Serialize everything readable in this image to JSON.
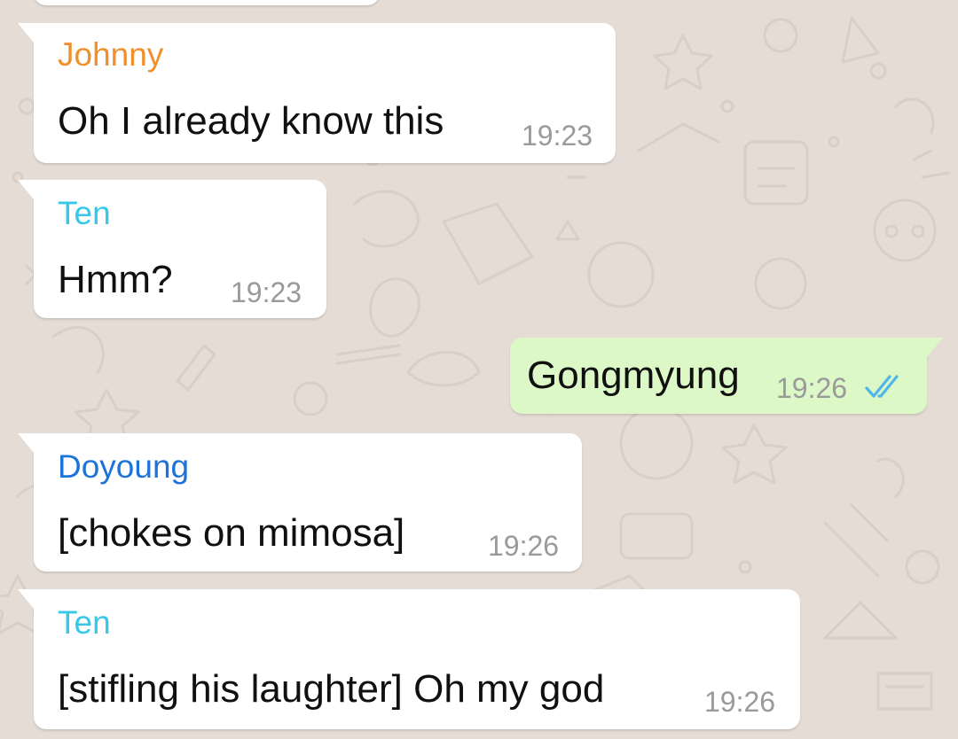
{
  "chat": {
    "messages": [
      {
        "direction": "incoming",
        "sender": "Johnny",
        "sender_color": "#f0902c",
        "text": "Oh I already know this",
        "time": "19:23"
      },
      {
        "direction": "incoming",
        "sender": "Ten",
        "sender_color": "#35c8e8",
        "text": "Hmm?",
        "time": "19:23"
      },
      {
        "direction": "outgoing",
        "text": "Gongmyung",
        "time": "19:26",
        "status_icon": "double-check-read-icon"
      },
      {
        "direction": "incoming",
        "sender": "Doyoung",
        "sender_color": "#1e73d8",
        "text": "[chokes on mimosa]",
        "time": "19:26"
      },
      {
        "direction": "incoming",
        "sender": "Ten",
        "sender_color": "#35c8e8",
        "text": "[stifling his laughter] Oh my god",
        "time": "19:26"
      }
    ]
  },
  "colors": {
    "wallpaper": "#e5ddd5",
    "incoming_bubble": "#ffffff",
    "outgoing_bubble": "#dcf8c6",
    "read_ticks": "#4fb6ec",
    "timestamp": "#9a9a9a"
  }
}
